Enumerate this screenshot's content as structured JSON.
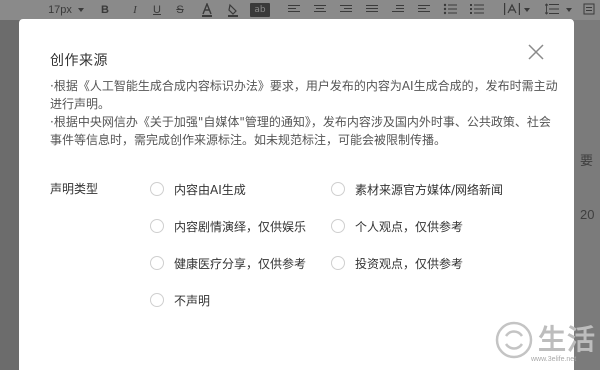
{
  "toolbar": {
    "font_size": "17px",
    "bold": "B",
    "italic": "I",
    "underline": "U",
    "strike": "S",
    "highlight": "ab"
  },
  "background": {
    "right_char_1": "要",
    "right_char_2": "20"
  },
  "dialog": {
    "title": "创作来源",
    "description": [
      "·根据《人工智能生成合成内容标识办法》要求，用户发布的内容为AI生成合成的，发布时需主动进行声明。",
      "·根据中央网信办《关于加强\"自媒体\"管理的通知》，发布内容涉及国内外时事、公共政策、社会事件等信息时，需完成创作来源标注。如未规范标注，可能会被限制传播。"
    ],
    "type_label": "声明类型",
    "options": [
      "内容由AI生成",
      "素材来源官方媒体/网络新闻",
      "内容剧情演绎，仅供娱乐",
      "个人观点，仅供参考",
      "健康医疗分享，仅供参考",
      "投资观点，仅供参考",
      "不声明"
    ]
  },
  "watermark": {
    "text": "生活",
    "url": "www.3elife.net"
  }
}
